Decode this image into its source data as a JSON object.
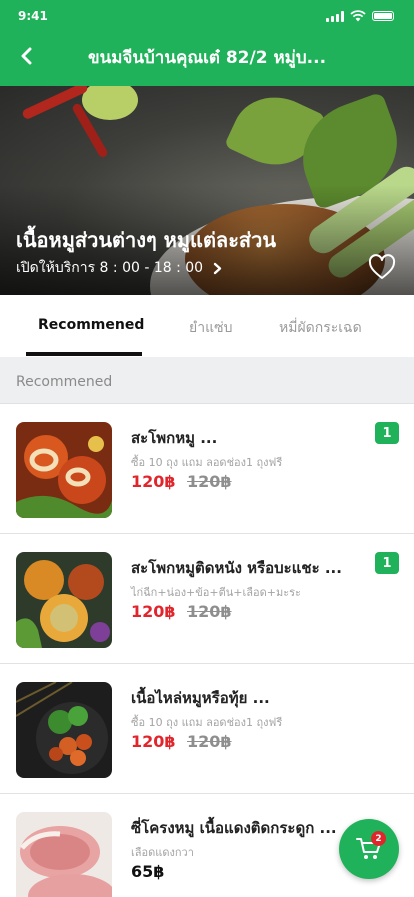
{
  "status_bar": {
    "time": "9:41"
  },
  "header": {
    "title": "ขนมจีนบ้านคุณเต๋ 82/2 หมู่บ..."
  },
  "hero": {
    "title": "เนื้อหมูส่วนต่างๆ หมูแต่ละส่วน",
    "hours": "เปิดให้บริการ 8 : 00 - 18 : 00"
  },
  "tabs": [
    {
      "label": "Recommened"
    },
    {
      "label": "ยำแซ่บ"
    },
    {
      "label": "หมี่ผัดกระเฉด"
    }
  ],
  "section_title": "Recommened",
  "items": [
    {
      "name": "สะโพกหมู ...",
      "desc": "ซื้อ 10 ถุง แถม ลอดช่อง1 ถุงฟรี",
      "price": "120฿",
      "old_price": "120฿",
      "qty": "1"
    },
    {
      "name": "สะโพกหมูติดหนัง หรือบะแชะ ...",
      "desc": "ไก่ฉีก+น่อง+ข้อ+ตีน+เลือด+มะระ",
      "price": "120฿",
      "old_price": "120฿",
      "qty": "1"
    },
    {
      "name": "เนื้อไหล่หมูหรือทุ้ย ...",
      "desc": "ซื้อ 10 ถุง แถม ลอดช่อง1 ถุงฟรี",
      "price": "120฿",
      "old_price": "120฿"
    },
    {
      "name": "ซี่โครงหมู เนื้อแดงติดกระดูก ...",
      "desc": "เลือดแดงกวา",
      "price": "65฿"
    }
  ],
  "cart": {
    "count": "2"
  },
  "colors": {
    "brand_green": "#1fb25a",
    "price_red": "#e0262c"
  }
}
